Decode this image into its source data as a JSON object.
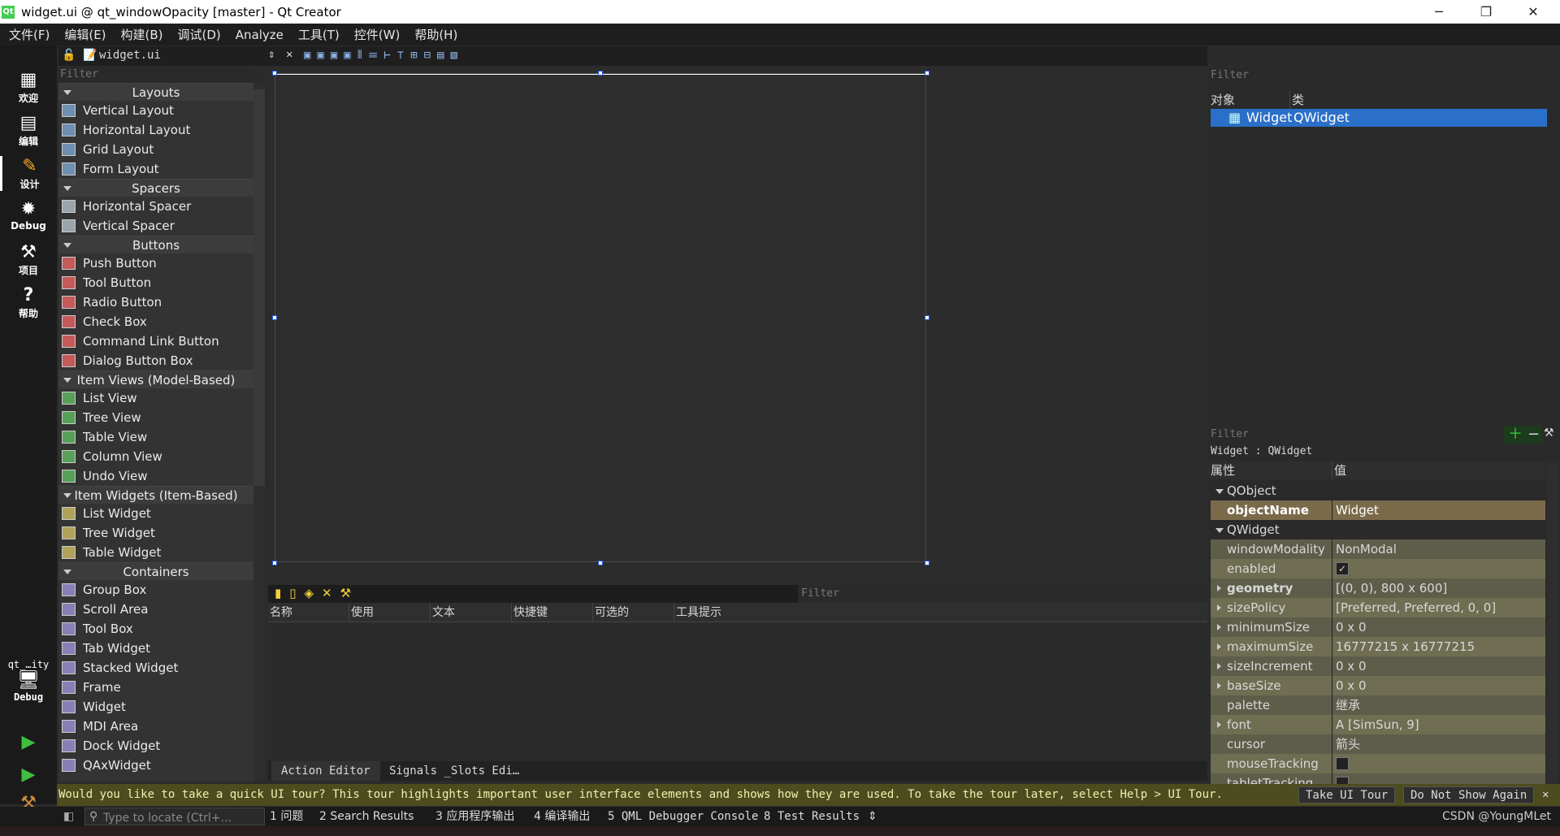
{
  "window": {
    "title": "widget.ui @ qt_windowOpacity [master] - Qt Creator"
  },
  "menu": [
    "文件(F)",
    "编辑(E)",
    "构建(B)",
    "调试(D)",
    "Analyze",
    "工具(T)",
    "控件(W)",
    "帮助(H)"
  ],
  "modes": [
    {
      "label": "欢迎",
      "icon": "grid-icon"
    },
    {
      "label": "编辑",
      "icon": "edit-icon"
    },
    {
      "label": "设计",
      "icon": "pencil-icon"
    },
    {
      "label": "Debug",
      "icon": "bug-icon"
    },
    {
      "label": "项目",
      "icon": "wrench-icon"
    },
    {
      "label": "帮助",
      "icon": "help-icon"
    }
  ],
  "kit": {
    "project": "qt_…ity",
    "build": "Debug"
  },
  "editor_tab": {
    "filename": "widget.ui"
  },
  "widgetbox": {
    "filter_placeholder": "Filter",
    "categories": [
      {
        "title": "Layouts",
        "items": [
          "Vertical Layout",
          "Horizontal Layout",
          "Grid Layout",
          "Form Layout"
        ]
      },
      {
        "title": "Spacers",
        "items": [
          "Horizontal Spacer",
          "Vertical Spacer"
        ]
      },
      {
        "title": "Buttons",
        "items": [
          "Push Button",
          "Tool Button",
          "Radio Button",
          "Check Box",
          "Command Link Button",
          "Dialog Button Box"
        ]
      },
      {
        "title": "Item Views (Model-Based)",
        "items": [
          "List View",
          "Tree View",
          "Table View",
          "Column View",
          "Undo View"
        ]
      },
      {
        "title": "Item Widgets (Item-Based)",
        "items": [
          "List Widget",
          "Tree Widget",
          "Table Widget"
        ]
      },
      {
        "title": "Containers",
        "items": [
          "Group Box",
          "Scroll Area",
          "Tool Box",
          "Tab Widget",
          "Stacked Widget",
          "Frame",
          "Widget",
          "MDI Area",
          "Dock Widget",
          "QAxWidget"
        ]
      }
    ]
  },
  "action_editor": {
    "filter_placeholder": "Filter",
    "columns": [
      "名称",
      "使用",
      "文本",
      "快捷键",
      "可选的",
      "工具提示"
    ],
    "tabs": [
      "Action Editor",
      "Signals _Slots Edi…"
    ]
  },
  "object_inspector": {
    "filter_placeholder": "Filter",
    "columns": [
      "对象",
      "类"
    ],
    "rows": [
      {
        "object": "Widget",
        "class": "QWidget"
      }
    ]
  },
  "property_editor": {
    "filter_placeholder": "Filter",
    "title": "Widget : QWidget",
    "columns": [
      "属性",
      "值"
    ],
    "rows": [
      {
        "name": "QObject",
        "value": "",
        "kind": "group"
      },
      {
        "name": "objectName",
        "value": "Widget",
        "kind": "obj"
      },
      {
        "name": "QWidget",
        "value": "",
        "kind": "group"
      },
      {
        "name": "windowModality",
        "value": "NonModal",
        "kind": "q1"
      },
      {
        "name": "enabled",
        "value": "✓",
        "kind": "q2"
      },
      {
        "name": "geometry",
        "value": "[(0, 0), 800 x 600]",
        "kind": "q1",
        "expandable": true,
        "bold": true
      },
      {
        "name": "sizePolicy",
        "value": "[Preferred, Preferred, 0, 0]",
        "kind": "q2",
        "expandable": true
      },
      {
        "name": "minimumSize",
        "value": "0 x 0",
        "kind": "q1",
        "expandable": true
      },
      {
        "name": "maximumSize",
        "value": "16777215 x 16777215",
        "kind": "q2",
        "expandable": true
      },
      {
        "name": "sizeIncrement",
        "value": "0 x 0",
        "kind": "q1",
        "expandable": true
      },
      {
        "name": "baseSize",
        "value": "0 x 0",
        "kind": "q2",
        "expandable": true
      },
      {
        "name": "palette",
        "value": "继承",
        "kind": "q1"
      },
      {
        "name": "font",
        "value": "A  [SimSun, 9]",
        "kind": "q2",
        "expandable": true
      },
      {
        "name": "cursor",
        "value": "箭头",
        "kind": "q1"
      },
      {
        "name": "mouseTracking",
        "value": "",
        "kind": "q2"
      },
      {
        "name": "tabletTracking",
        "value": "",
        "kind": "q1"
      }
    ]
  },
  "tour": {
    "message": "Would you like to take a quick UI tour? This tour highlights important user interface elements and shows how they are used. To take the tour later, select Help > UI Tour.",
    "take_label": "Take UI Tour",
    "dismiss_label": "Do Not Show Again"
  },
  "statusbar": {
    "locator_placeholder": "Type to locate (Ctrl+...",
    "panes": [
      "1 问题",
      "2 Search Results",
      "3 应用程序输出",
      "4 编译输出",
      "5 QML Debugger Console",
      "8 Test Results"
    ],
    "watermark": "CSDN @YoungMLet"
  },
  "colors": {
    "selection": "#2a6fc9",
    "group_text": "#ff2020",
    "tour_bg": "#4c4c1e"
  }
}
